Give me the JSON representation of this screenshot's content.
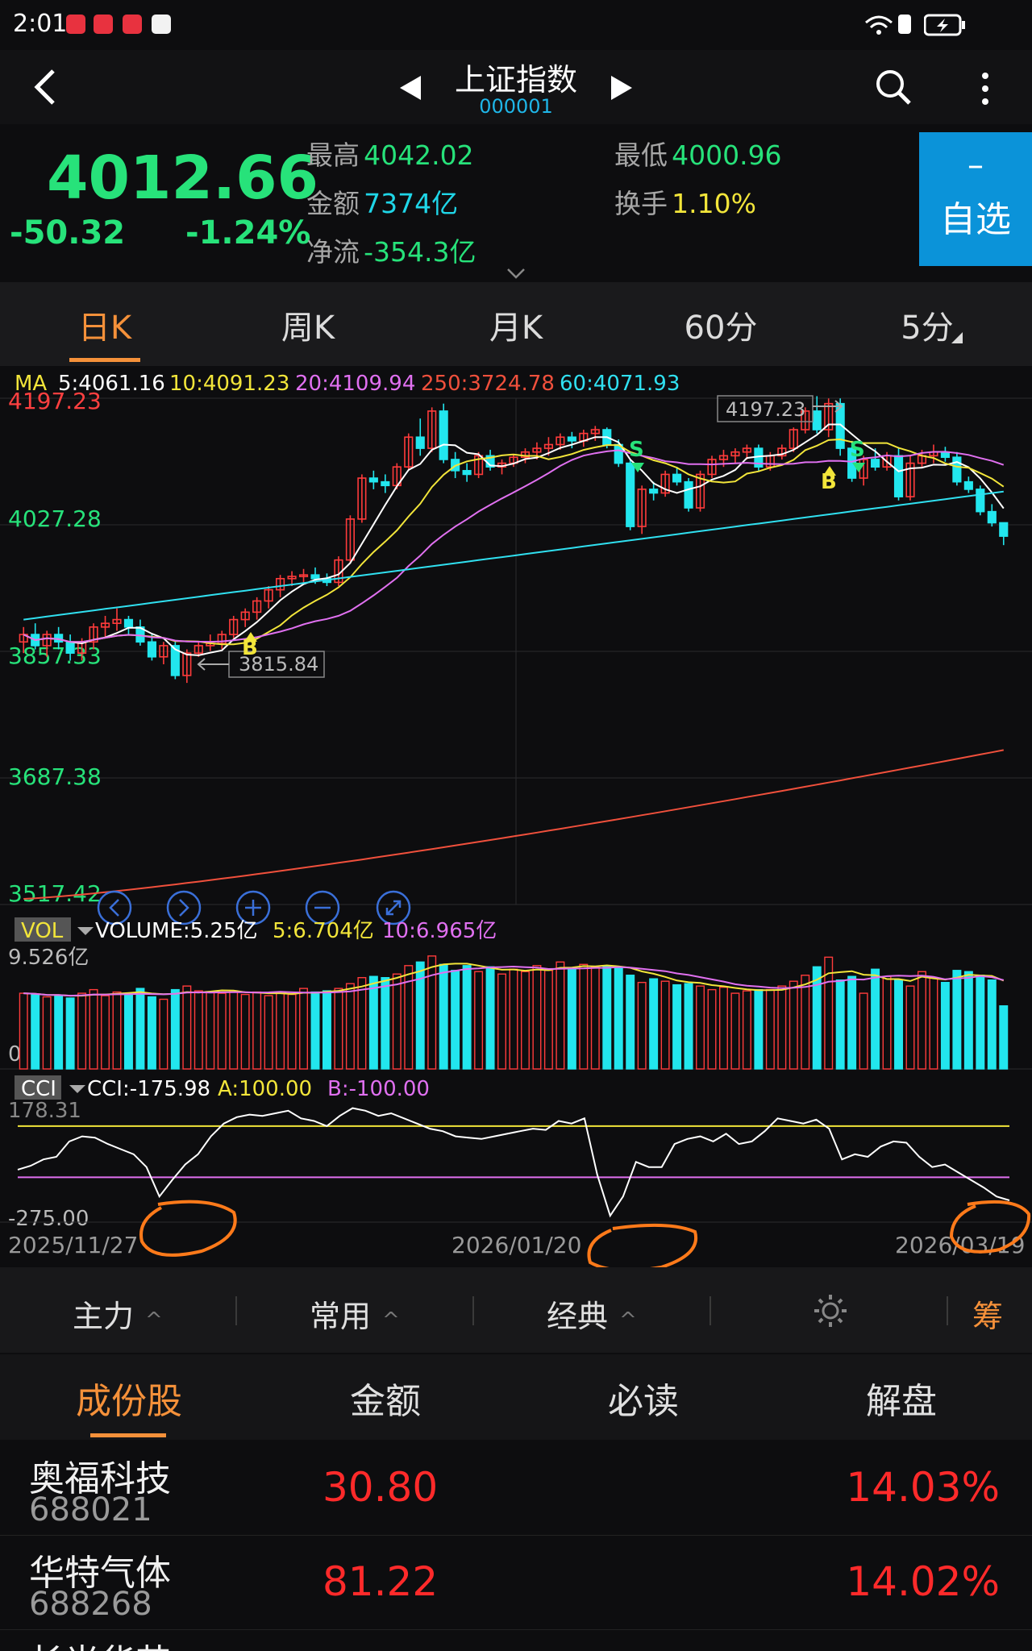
{
  "status": {
    "time": "2:01"
  },
  "header": {
    "title": "上证指数",
    "code": "000001"
  },
  "quote": {
    "last": "4012.66",
    "change": "-50.32",
    "change_pct": "-1.24%",
    "high_label": "最高",
    "high": "4042.02",
    "low_label": "最低",
    "low": "4000.96",
    "amount_label": "金额",
    "amount": "7374亿",
    "turnover_label": "换手",
    "turnover": "1.10%",
    "netflow_label": "净流",
    "netflow": "-354.3亿",
    "watch_dash": "–",
    "watch_label": "自选",
    "up_color": "#ff3b3b",
    "down_color": "#27e27a"
  },
  "period_tabs": [
    "日K",
    "周K",
    "月K",
    "60分",
    "5分"
  ],
  "ma": {
    "prefix": "MA",
    "ma5": "5:4061.16",
    "ma10": "10:4091.23",
    "ma20": "20:4109.94",
    "ma250": "250:3724.78",
    "ma60": "60:4071.93"
  },
  "chart_labels": {
    "y_ticks": [
      "4197.23",
      "4027.28",
      "3857.33",
      "3687.38",
      "3517.42"
    ],
    "high_marker": "4197.23",
    "low_marker": "3815.84",
    "vol_tag": "VOL",
    "vol_text": "VOLUME:5.25亿",
    "vol5": "5:6.704亿",
    "vol10": "10:6.965亿",
    "vol_max": "9.526亿",
    "vol_zero": "0",
    "cci_tag": "CCI",
    "cci_text": "CCI:-175.98",
    "cci_a": "A:100.00",
    "cci_b": "B:-100.00",
    "cci_max": "178.31",
    "cci_min": "-275.00",
    "dates": [
      "2025/11/27",
      "2026/01/20",
      "2026/03/19"
    ],
    "signal_b": "B",
    "signal_s": "S"
  },
  "chart_data": {
    "type": "candlestick",
    "price_range": [
      3517.42,
      4197.23
    ],
    "candles": [
      [
        3870,
        3890,
        3855,
        3880
      ],
      [
        3880,
        3895,
        3860,
        3865
      ],
      [
        3865,
        3885,
        3850,
        3880
      ],
      [
        3880,
        3890,
        3860,
        3870
      ],
      [
        3870,
        3880,
        3845,
        3855
      ],
      [
        3855,
        3875,
        3845,
        3870
      ],
      [
        3870,
        3895,
        3860,
        3890
      ],
      [
        3890,
        3905,
        3875,
        3895
      ],
      [
        3895,
        3915,
        3885,
        3900
      ],
      [
        3900,
        3905,
        3880,
        3890
      ],
      [
        3890,
        3900,
        3865,
        3870
      ],
      [
        3870,
        3880,
        3845,
        3850
      ],
      [
        3850,
        3870,
        3840,
        3865
      ],
      [
        3865,
        3870,
        3820,
        3825
      ],
      [
        3825,
        3860,
        3815,
        3855
      ],
      [
        3855,
        3870,
        3850,
        3865
      ],
      [
        3865,
        3880,
        3858,
        3868
      ],
      [
        3868,
        3885,
        3860,
        3880
      ],
      [
        3880,
        3905,
        3875,
        3900
      ],
      [
        3900,
        3915,
        3890,
        3910
      ],
      [
        3910,
        3930,
        3900,
        3925
      ],
      [
        3925,
        3945,
        3915,
        3940
      ],
      [
        3940,
        3960,
        3930,
        3955
      ],
      [
        3955,
        3965,
        3945,
        3958
      ],
      [
        3958,
        3968,
        3950,
        3960
      ],
      [
        3960,
        3970,
        3948,
        3955
      ],
      [
        3955,
        3962,
        3945,
        3950
      ],
      [
        3950,
        3985,
        3945,
        3980
      ],
      [
        3980,
        4040,
        3975,
        4035
      ],
      [
        4035,
        4095,
        4030,
        4090
      ],
      [
        4090,
        4100,
        4075,
        4085
      ],
      [
        4085,
        4095,
        4070,
        4080
      ],
      [
        4080,
        4110,
        4075,
        4105
      ],
      [
        4105,
        4150,
        4100,
        4145
      ],
      [
        4145,
        4170,
        4120,
        4130
      ],
      [
        4130,
        4185,
        4125,
        4180
      ],
      [
        4180,
        4190,
        4110,
        4115
      ],
      [
        4115,
        4125,
        4090,
        4100
      ],
      [
        4100,
        4110,
        4085,
        4095
      ],
      [
        4095,
        4125,
        4090,
        4120
      ],
      [
        4120,
        4128,
        4100,
        4105
      ],
      [
        4105,
        4115,
        4095,
        4110
      ],
      [
        4110,
        4122,
        4105,
        4118
      ],
      [
        4118,
        4130,
        4110,
        4125
      ],
      [
        4125,
        4138,
        4115,
        4130
      ],
      [
        4130,
        4145,
        4120,
        4135
      ],
      [
        4135,
        4150,
        4128,
        4145
      ],
      [
        4145,
        4152,
        4130,
        4140
      ],
      [
        4140,
        4155,
        4132,
        4150
      ],
      [
        4150,
        4160,
        4140,
        4155
      ],
      [
        4155,
        4158,
        4130,
        4135
      ],
      [
        4135,
        4142,
        4105,
        4110
      ],
      [
        4110,
        4115,
        4020,
        4025
      ],
      [
        4025,
        4080,
        4015,
        4075
      ],
      [
        4075,
        4085,
        4060,
        4070
      ],
      [
        4070,
        4100,
        4065,
        4095
      ],
      [
        4095,
        4105,
        4080,
        4085
      ],
      [
        4085,
        4090,
        4045,
        4050
      ],
      [
        4050,
        4100,
        4045,
        4095
      ],
      [
        4095,
        4120,
        4090,
        4115
      ],
      [
        4115,
        4128,
        4105,
        4120
      ],
      [
        4120,
        4130,
        4110,
        4125
      ],
      [
        4125,
        4135,
        4115,
        4130
      ],
      [
        4130,
        4135,
        4100,
        4105
      ],
      [
        4105,
        4125,
        4100,
        4120
      ],
      [
        4120,
        4135,
        4115,
        4130
      ],
      [
        4130,
        4158,
        4125,
        4155
      ],
      [
        4155,
        4185,
        4150,
        4180
      ],
      [
        4180,
        4200,
        4150,
        4155
      ],
      [
        4155,
        4197,
        4145,
        4190
      ],
      [
        4190,
        4197,
        4120,
        4130
      ],
      [
        4130,
        4140,
        4085,
        4090
      ],
      [
        4090,
        4120,
        4080,
        4115
      ],
      [
        4115,
        4130,
        4100,
        4105
      ],
      [
        4105,
        4125,
        4100,
        4120
      ],
      [
        4120,
        4130,
        4060,
        4065
      ],
      [
        4065,
        4120,
        4060,
        4110
      ],
      [
        4110,
        4128,
        4105,
        4120
      ],
      [
        4120,
        4135,
        4110,
        4125
      ],
      [
        4125,
        4132,
        4112,
        4118
      ],
      [
        4118,
        4125,
        4080,
        4085
      ],
      [
        4085,
        4092,
        4070,
        4075
      ],
      [
        4075,
        4080,
        4040,
        4045
      ],
      [
        4045,
        4055,
        4025,
        4030
      ],
      [
        4030,
        4030,
        4000,
        4012
      ]
    ],
    "volumes": [
      6.3,
      6.2,
      6.0,
      6.1,
      5.9,
      6.3,
      6.6,
      6.1,
      6.4,
      6.2,
      6.7,
      6.0,
      5.8,
      6.6,
      6.9,
      6.5,
      6.4,
      6.3,
      6.5,
      6.2,
      6.4,
      6.1,
      6.3,
      6.2,
      6.7,
      6.4,
      6.5,
      6.7,
      7.1,
      7.6,
      7.7,
      7.6,
      7.9,
      8.6,
      8.9,
      9.4,
      8.7,
      8.2,
      8.6,
      8.1,
      8.5,
      7.9,
      8.3,
      8.1,
      8.6,
      8.2,
      8.9,
      8.4,
      8.7,
      8.5,
      8.6,
      8.5,
      7.8,
      7.2,
      7.5,
      7.3,
      7.0,
      7.1,
      6.9,
      6.6,
      6.8,
      6.3,
      6.5,
      6.6,
      6.6,
      6.9,
      7.3,
      7.8,
      8.5,
      9.3,
      7.4,
      7.7,
      6.3,
      8.3,
      7.7,
      7.4,
      6.9,
      8.1,
      7.6,
      7.2,
      8.2,
      8.1,
      7.8,
      7.4,
      5.25
    ],
    "cci": [
      -70,
      -55,
      -30,
      -20,
      40,
      60,
      55,
      30,
      10,
      -10,
      -60,
      -175,
      -110,
      -50,
      -10,
      60,
      110,
      135,
      145,
      140,
      150,
      160,
      130,
      120,
      100,
      140,
      170,
      160,
      140,
      150,
      130,
      110,
      90,
      80,
      60,
      55,
      50,
      60,
      70,
      80,
      90,
      85,
      120,
      110,
      130,
      -90,
      -250,
      -175,
      -40,
      -60,
      -60,
      30,
      50,
      60,
      40,
      70,
      30,
      40,
      80,
      130,
      120,
      110,
      125,
      90,
      -30,
      -10,
      -20,
      20,
      40,
      35,
      -20,
      -60,
      -50,
      -80,
      -110,
      -140,
      -175,
      -190
    ]
  },
  "tool_tabs": {
    "t1": "主力",
    "t2": "常用",
    "t3": "经典",
    "t4": "筹",
    "caret": "^"
  },
  "sub_tabs": [
    "成份股",
    "金额",
    "必读",
    "解盘"
  ],
  "stocks": [
    {
      "name": "奥福科技",
      "code": "688021",
      "price": "30.80",
      "pct": "14.03%"
    },
    {
      "name": "华特气体",
      "code": "688268",
      "price": "81.22",
      "pct": "14.02%"
    },
    {
      "name": "长光华芯",
      "code": "",
      "price": "",
      "pct": ""
    }
  ]
}
